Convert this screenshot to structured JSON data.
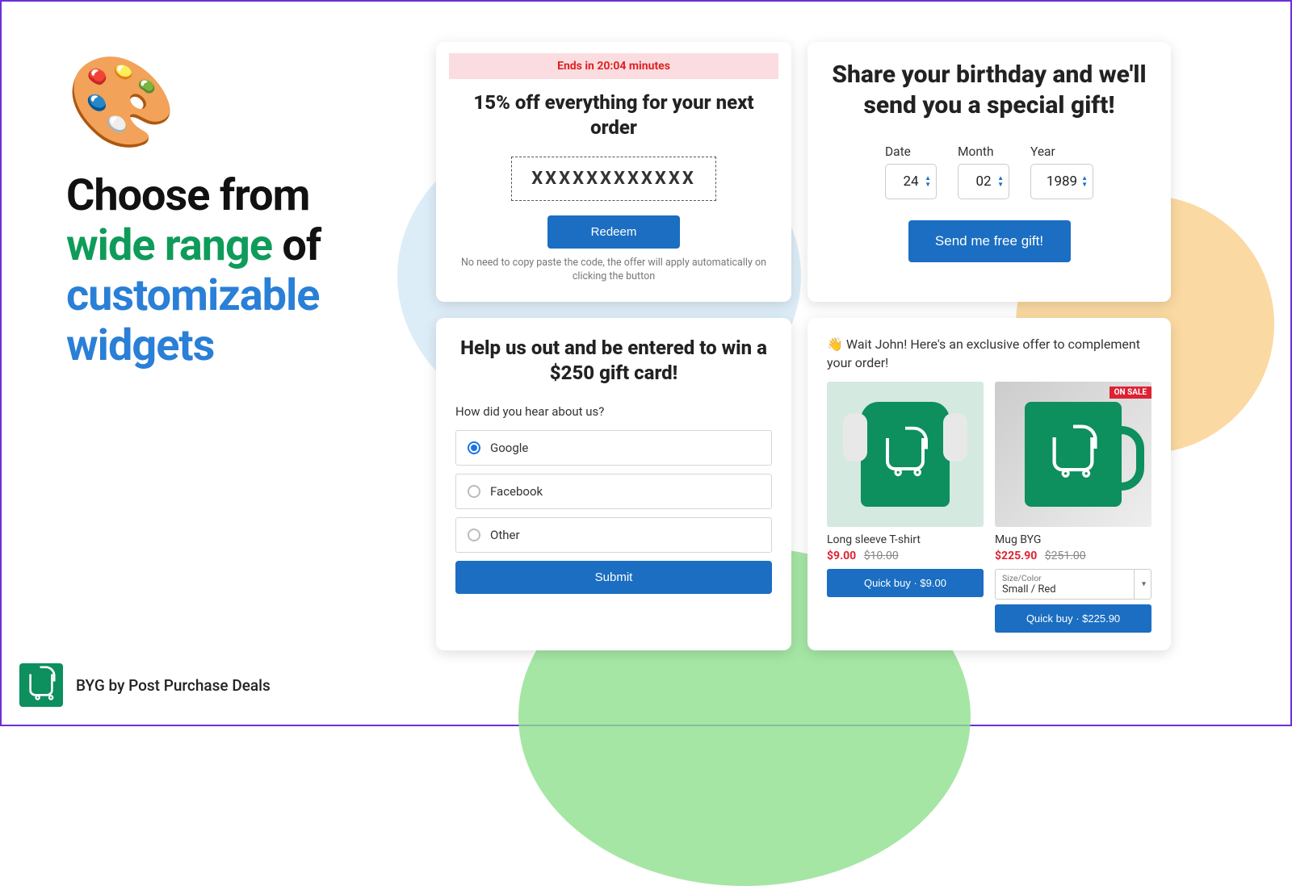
{
  "headline": {
    "l1": "Choose from",
    "l2_green": "wide range",
    "l2_rest": " of",
    "l3": "customizable",
    "l4": "widgets"
  },
  "promo": {
    "timer": "Ends in 20:04 minutes",
    "title": "15% off everything for your next order",
    "code": "XXXXXXXXXXXX",
    "redeem_label": "Redeem",
    "disclaimer": "No need to copy paste the code, the offer will apply automatically on clicking the button"
  },
  "birthday": {
    "title": "Share your birthday and we'll send you a special gift!",
    "date_label": "Date",
    "date_value": "24",
    "month_label": "Month",
    "month_value": "02",
    "year_label": "Year",
    "year_value": "1989",
    "send_label": "Send me free gift!"
  },
  "survey": {
    "title": "Help us out and be entered to win a $250 gift card!",
    "question": "How did you hear about us?",
    "opt1": "Google",
    "opt2": "Facebook",
    "opt3": "Other",
    "submit_label": "Submit"
  },
  "upsell": {
    "intro": "👋 Wait John! Here's an exclusive offer to complement your order!",
    "products": [
      {
        "name": "Long sleeve T-shirt",
        "price_now": "$9.00",
        "price_old": "$10.00",
        "buy_label": "Quick buy · $9.00",
        "on_sale": false
      },
      {
        "name": "Mug BYG",
        "price_now": "$225.90",
        "price_old": "$251.00",
        "buy_label": "Quick buy · $225.90",
        "on_sale": true,
        "sale_badge": "ON SALE",
        "variant_label": "Size/Color",
        "variant_value": "Small / Red"
      }
    ]
  },
  "footer": {
    "brand": "BYG by Post Purchase Deals"
  }
}
